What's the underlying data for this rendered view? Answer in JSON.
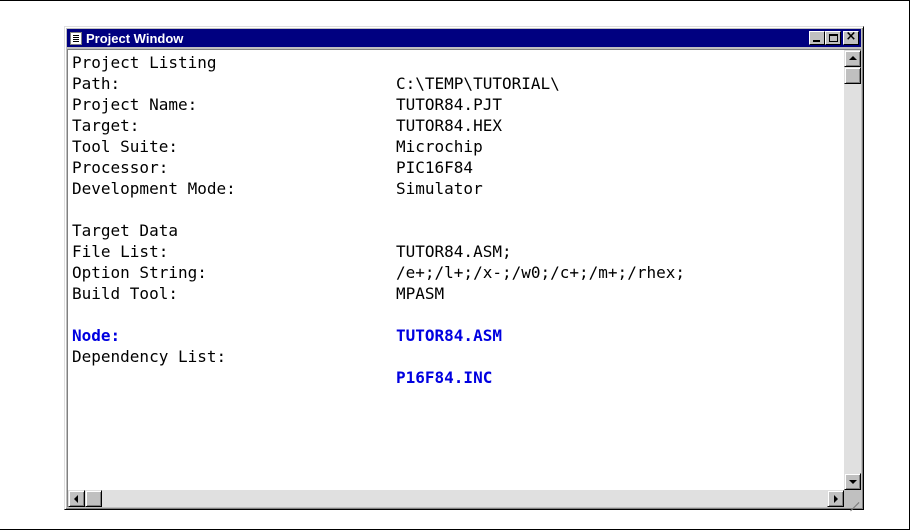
{
  "window": {
    "title": "Project Window"
  },
  "listing": {
    "header": "Project Listing",
    "rows": [
      {
        "label": "Path:",
        "value": "C:\\TEMP\\TUTORIAL\\"
      },
      {
        "label": "Project Name:",
        "value": "TUTOR84.PJT"
      },
      {
        "label": "Target:",
        "value": "TUTOR84.HEX"
      },
      {
        "label": "Tool Suite:",
        "value": "Microchip"
      },
      {
        "label": "Processor:",
        "value": "PIC16F84"
      },
      {
        "label": "Development Mode:",
        "value": "Simulator"
      }
    ]
  },
  "target_data": {
    "header": "Target Data",
    "rows": [
      {
        "label": "File List:",
        "value": "TUTOR84.ASM;"
      },
      {
        "label": "Option String:",
        "value": "/e+;/l+;/x-;/w0;/c+;/m+;/rhex;"
      },
      {
        "label": "Build Tool:",
        "value": "MPASM"
      }
    ]
  },
  "node": {
    "label": "Node:",
    "value": "TUTOR84.ASM",
    "dependency_label": "Dependency List:",
    "dependency_value": "P16F84.INC",
    "color": "#0000e0"
  }
}
